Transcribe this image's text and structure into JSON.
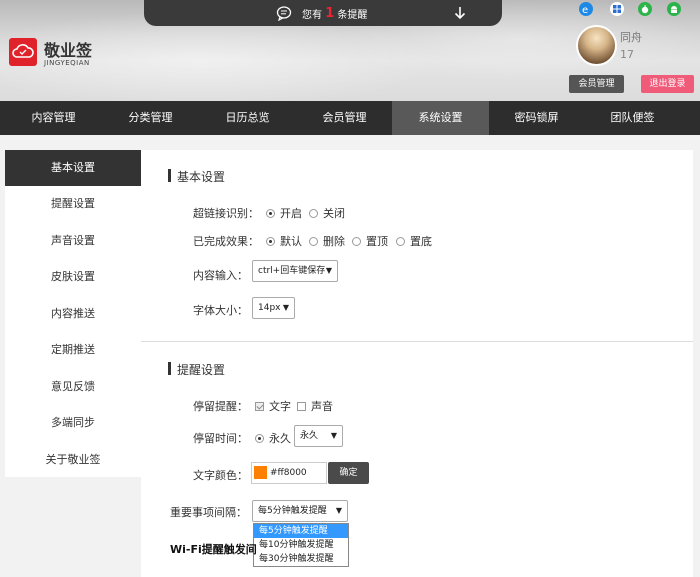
{
  "notice": {
    "prefix": "您有",
    "count": "1",
    "suffix": "条提醒"
  },
  "logo": {
    "name": "敬业签",
    "pinyin": "JINGYEQIAN"
  },
  "platforms": [
    "ie-icon",
    "windows-icon",
    "apple-icon",
    "android-icon"
  ],
  "user": {
    "name": "同舟",
    "id": "17",
    "member_btn": "会员管理",
    "logout_btn": "退出登录"
  },
  "nav": [
    "内容管理",
    "分类管理",
    "日历总览",
    "会员管理",
    "系统设置",
    "密码锁屏",
    "团队便签"
  ],
  "sidebar": [
    "基本设置",
    "提醒设置",
    "声音设置",
    "皮肤设置",
    "内容推送",
    "定期推送",
    "意见反馈",
    "多端同步",
    "关于敬业签"
  ],
  "basic": {
    "title": "基本设置",
    "hyperlink_label": "超链接识别：",
    "hyperlink_on": "开启",
    "hyperlink_off": "关闭",
    "done_label": "已完成效果：",
    "done_opts": [
      "默认",
      "删除",
      "置顶",
      "置底"
    ],
    "input_label": "内容输入：",
    "input_value": "ctrl+回车键保存",
    "font_label": "字体大小：",
    "font_value": "14px"
  },
  "remind": {
    "title": "提醒设置",
    "stay_label": "停留提醒：",
    "stay_text": "文字",
    "stay_sound": "声音",
    "time_label": "停留时间：",
    "time_forever": "永久",
    "time_select": "永久",
    "color_label": "文字颜色：",
    "color_value": "#ff8000",
    "confirm_btn": "确定",
    "interval_label": "重要事项间隔：",
    "interval_value": "每5分钟触发提醒",
    "interval_options": [
      "每5分钟触发提醒",
      "每10分钟触发提醒",
      "每30分钟触发提醒"
    ],
    "wifi_label": "Wi-Fi提醒触发间"
  },
  "colors": {
    "brand_red": "#e0232a",
    "nav_bg": "#2d2d2d",
    "nav_active": "#595959",
    "logout_pink": "#ef5b78",
    "accent_orange": "#ff8000",
    "option_highlight": "#3399ff"
  }
}
